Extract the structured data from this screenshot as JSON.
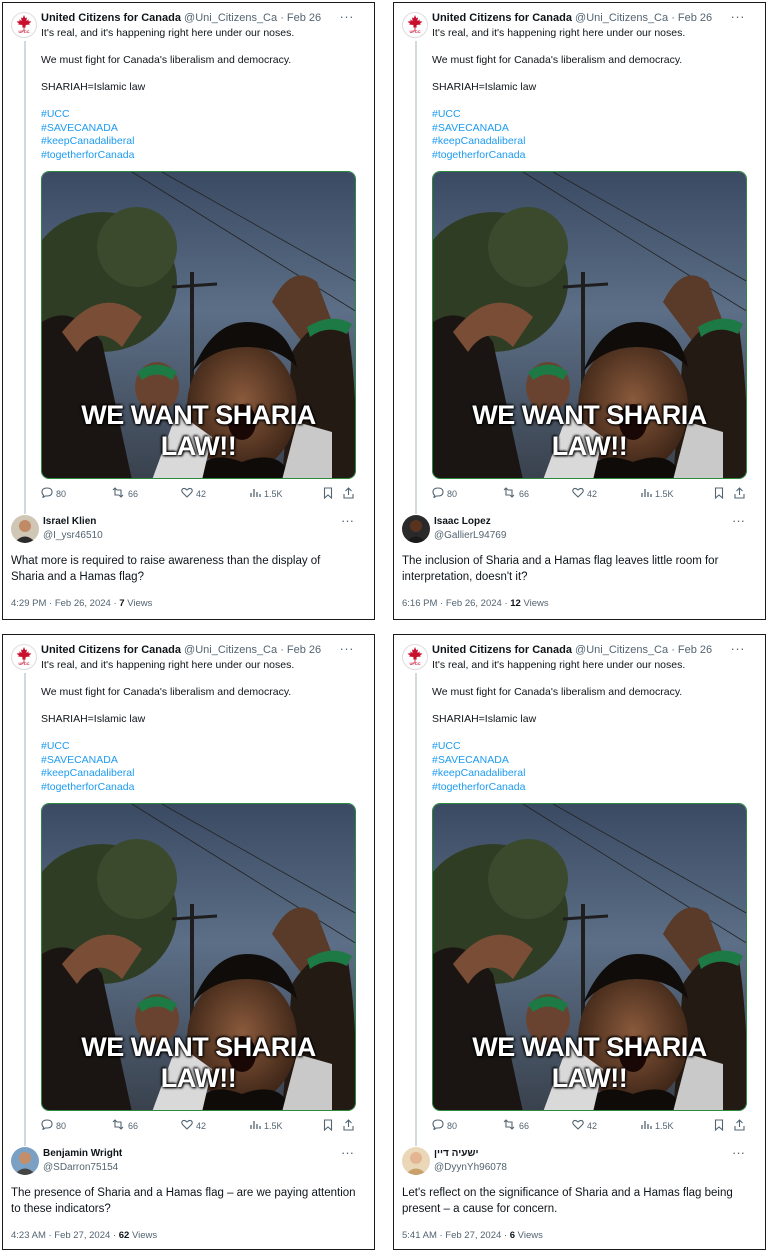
{
  "tweet": {
    "author": "United Citizens for Canada",
    "handle": "@Uni_Citizens_Ca",
    "separator": "·",
    "date": "Feb 26",
    "more": "···",
    "logo_text": "UFCC",
    "lines": [
      "It's real, and it's happening right here under our noses.",
      "We must fight for Canada's liberalism and democracy.",
      "SHARIAH=Islamic law"
    ],
    "hashtags": [
      "#UCC",
      "#SAVECANADA",
      "#keepCanadaliberal",
      "#togetherforCanada"
    ],
    "image_caption": "WE WANT SHARIA LAW!!",
    "stats": {
      "replies": "80",
      "retweets": "66",
      "likes": "42",
      "views": "1.5K"
    }
  },
  "icons": {
    "reply": "reply-icon",
    "retweet": "retweet-icon",
    "like": "heart-icon",
    "views": "views-icon",
    "bookmark": "bookmark-icon",
    "share": "share-icon"
  },
  "colors": {
    "hashtag": "#1d9bf0",
    "secondary_text": "#536471",
    "image_border": "#2d8a3e",
    "logo_red": "#c8102e"
  },
  "replies": [
    {
      "name": "Israel Klien",
      "handle": "@I_ysr46510",
      "text": "What more is required to raise awareness than the display of Sharia and a Hamas flag?",
      "time": "4:29 PM · Feb 26, 2024 · ",
      "views_count": "7",
      "views_label": " Views"
    },
    {
      "name": "Isaac Lopez",
      "handle": "@GallierL94769",
      "text": "The inclusion of Sharia and a Hamas flag leaves little room for interpretation, doesn't it?",
      "time": "6:16 PM · Feb 26, 2024 · ",
      "views_count": "12",
      "views_label": " Views"
    },
    {
      "name": "Benjamin Wright",
      "handle": "@SDarron75154",
      "text": "The presence of Sharia and a Hamas flag – are we paying attention to these indicators?",
      "time": "4:23 AM · Feb 27, 2024 · ",
      "views_count": "62",
      "views_label": " Views"
    },
    {
      "name": "ישעיה דיין",
      "handle": "@DyynYh96078",
      "text": "Let's reflect on the significance of Sharia and a Hamas flag being present – a cause for concern.",
      "time": "5:41 AM · Feb 27, 2024 · ",
      "views_count": "6",
      "views_label": " Views"
    }
  ]
}
